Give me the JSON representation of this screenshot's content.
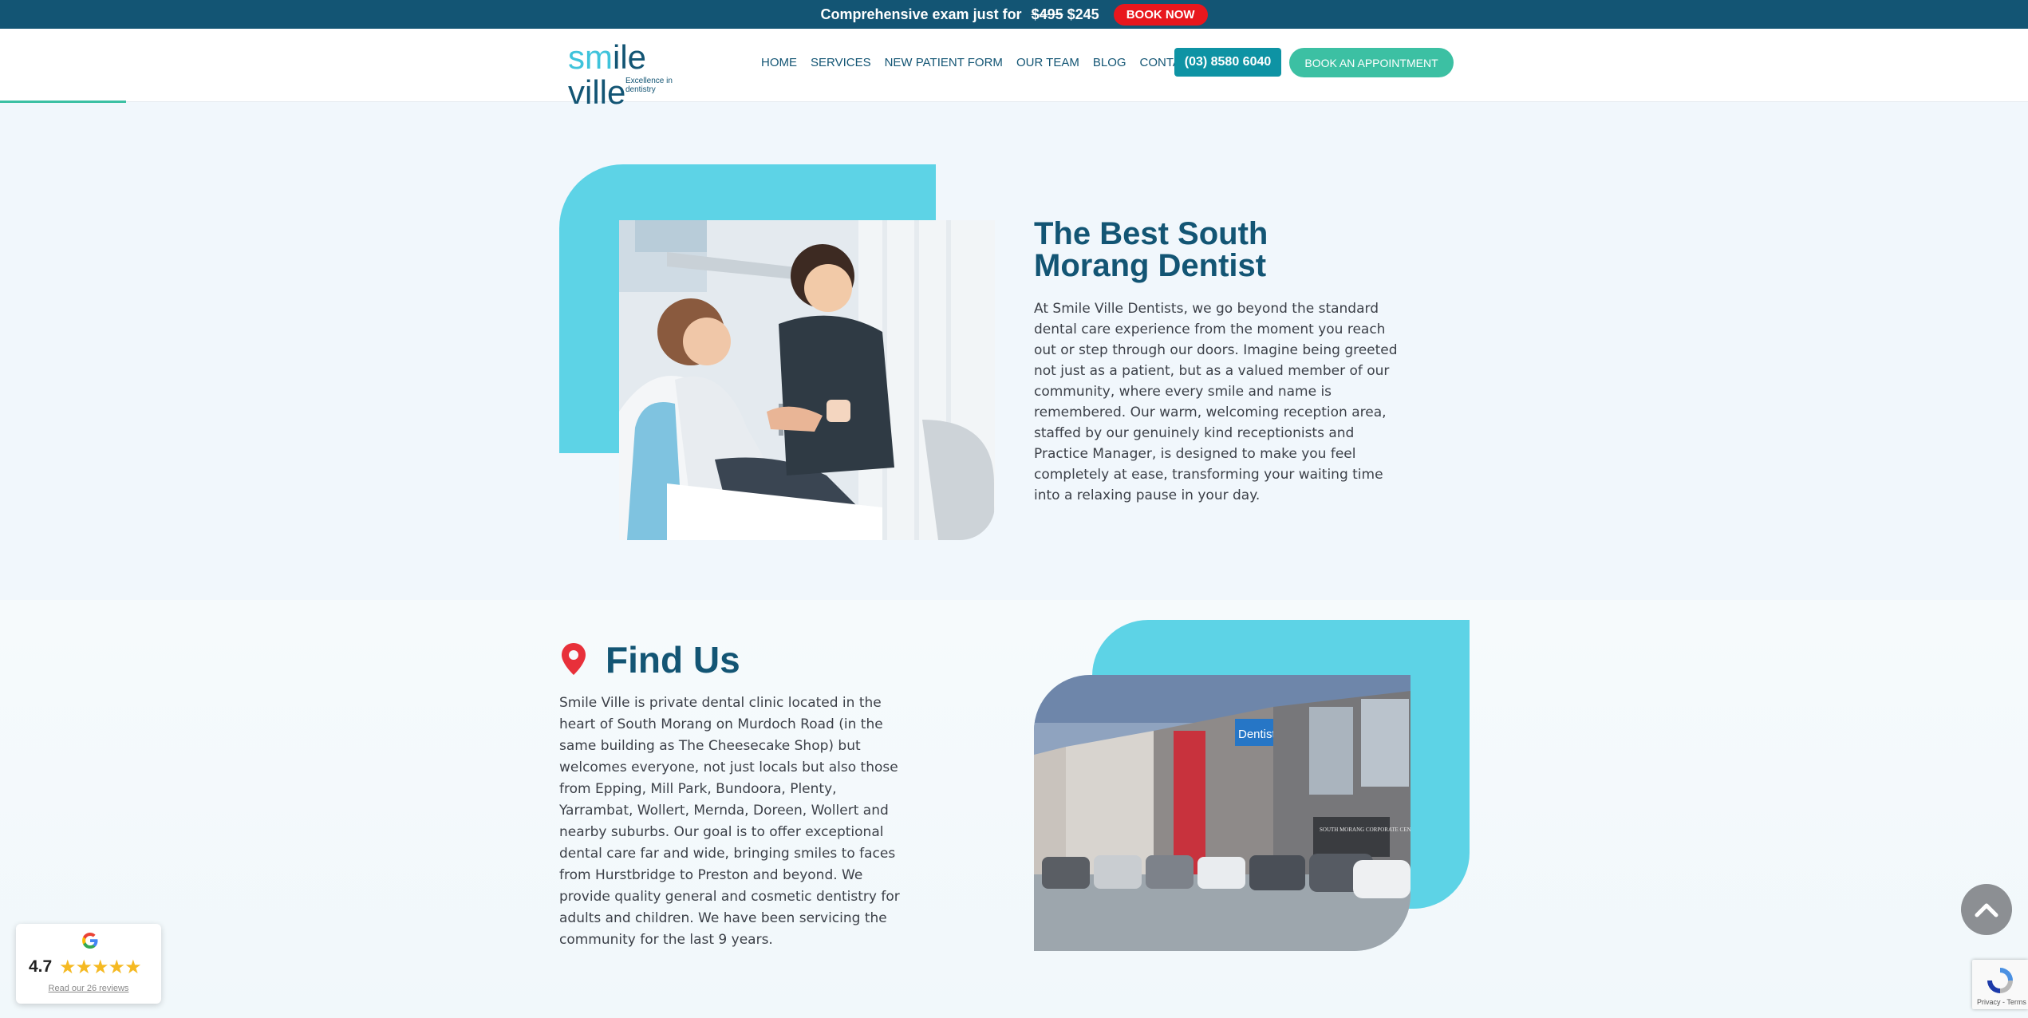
{
  "promo": {
    "text": "Comprehensive exam just for",
    "old_price": "$495",
    "new_price": "$245",
    "button": "BOOK NOW"
  },
  "header": {
    "logo_text_1": "sm",
    "logo_text_2": "ile ville",
    "logo_tagline": "Excellence in dentistry",
    "nav": [
      "HOME",
      "SERVICES",
      "NEW PATIENT FORM",
      "OUR TEAM",
      "BLOG",
      "CONTACT US"
    ],
    "phone": "(03) 8580 6040",
    "appointment": "BOOK AN APPOINTMENT"
  },
  "intro": {
    "title": "The Best South Morang Dentist",
    "body": "At Smile Ville Dentists, we go beyond the standard dental care experience from the moment you reach out or step through our doors. Imagine being greeted not just as a patient, but as a valued member of our community, where every smile and name is remembered. Our warm, welcoming reception area, staffed by our genuinely kind receptionists and Practice Manager, is designed to make you feel completely at ease, transforming your waiting time into a relaxing pause in your day."
  },
  "find_us": {
    "title": "Find Us",
    "body": "Smile Ville is private dental clinic located in the heart of South Morang on Murdoch Road (in the same building as The Cheesecake Shop) but welcomes everyone, not just locals but also those from Epping, Mill Park, Bundoora, Plenty, Yarrambat, Wollert, Mernda, Doreen, Wollert and nearby suburbs. Our goal is to offer exceptional dental care far and wide, bringing smiles to faces from Hurstbridge to Preston and beyond. We provide quality general and cosmetic dentistry for adults and children. We have been servicing the community for the last 9 years.",
    "sign_text": "Dentist",
    "building_sign": "SOUTH MORANG CORPORATE CENTRE"
  },
  "reviews": {
    "rating": "4.7",
    "stars": "★★★★★",
    "link": "Read our 26 reviews"
  },
  "recaptcha": {
    "text": "Privacy - Terms"
  },
  "colors": {
    "navy": "#135574",
    "cyan": "#5dd3e6",
    "teal": "#3cc0a3",
    "red": "#e8171d"
  }
}
